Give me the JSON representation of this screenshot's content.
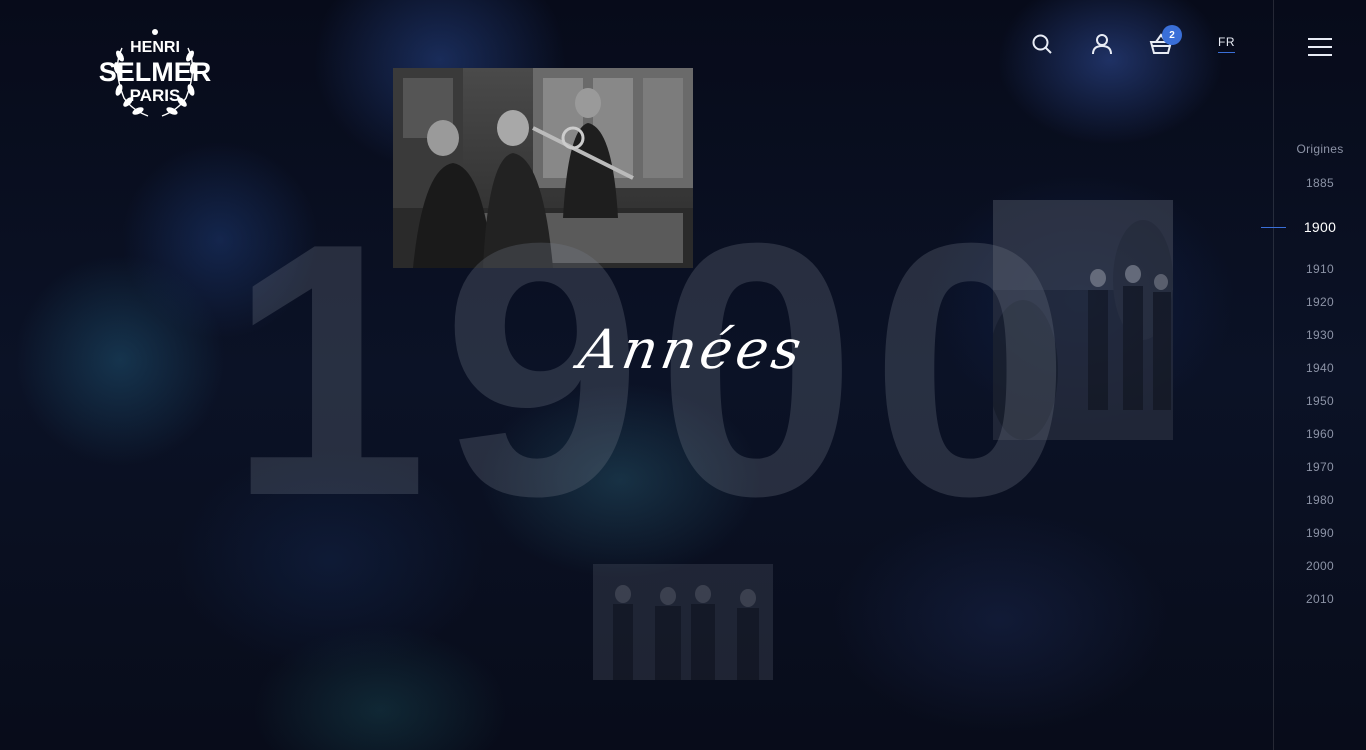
{
  "brand": {
    "line1": "HENRI",
    "line2": "SELMER",
    "line3": "PARIS"
  },
  "header": {
    "cart_count": "2",
    "language": "FR"
  },
  "hero": {
    "year": "1900",
    "subtitle": "Années"
  },
  "timeline": {
    "items": [
      {
        "label": "Origines",
        "active": false
      },
      {
        "label": "1885",
        "active": false
      },
      {
        "label": "1900",
        "active": true
      },
      {
        "label": "1910",
        "active": false
      },
      {
        "label": "1920",
        "active": false
      },
      {
        "label": "1930",
        "active": false
      },
      {
        "label": "1940",
        "active": false
      },
      {
        "label": "1950",
        "active": false
      },
      {
        "label": "1960",
        "active": false
      },
      {
        "label": "1970",
        "active": false
      },
      {
        "label": "1980",
        "active": false
      },
      {
        "label": "1990",
        "active": false
      },
      {
        "label": "2000",
        "active": false
      },
      {
        "label": "2010",
        "active": false
      }
    ]
  },
  "colors": {
    "accent": "#3a6fd8",
    "background": "#0a0f1f"
  }
}
